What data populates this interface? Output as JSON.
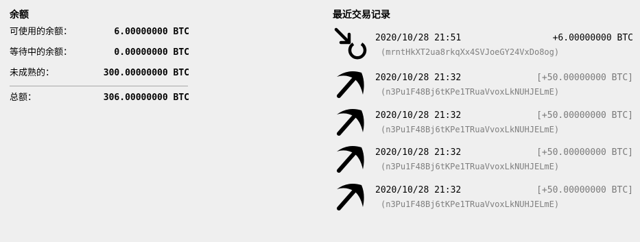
{
  "balance": {
    "title": "余额",
    "available_label": "可使用的余额：",
    "available_value": "6.00000000 BTC",
    "pending_label": "等待中的余额：",
    "pending_value": "0.00000000 BTC",
    "immature_label": "未成熟的：",
    "immature_value": "300.00000000 BTC",
    "total_label": "总额：",
    "total_value": "306.00000000 BTC"
  },
  "recent": {
    "title": "最近交易记录",
    "transactions": [
      {
        "icon": "received-icon",
        "date": "2020/10/28 21:51",
        "amount": "+6.00000000 BTC",
        "address": "(mrntHkXT2ua8rkqXx4SVJoeGY24VxDo8og)"
      },
      {
        "icon": "mined-pickaxe-icon",
        "date": "2020/10/28 21:32",
        "amount": "[+50.00000000 BTC]",
        "address": "(n3Pu1F48Bj6tKPe1TRuaVvoxLkNUHJELmE)"
      },
      {
        "icon": "mined-pickaxe-icon",
        "date": "2020/10/28 21:32",
        "amount": "[+50.00000000 BTC]",
        "address": "(n3Pu1F48Bj6tKPe1TRuaVvoxLkNUHJELmE)"
      },
      {
        "icon": "mined-pickaxe-icon",
        "date": "2020/10/28 21:32",
        "amount": "[+50.00000000 BTC]",
        "address": "(n3Pu1F48Bj6tKPe1TRuaVvoxLkNUHJELmE)"
      },
      {
        "icon": "mined-pickaxe-icon",
        "date": "2020/10/28 21:32",
        "amount": "[+50.00000000 BTC]",
        "address": "(n3Pu1F48Bj6tKPe1TRuaVvoxLkNUHJELmE)"
      }
    ]
  }
}
